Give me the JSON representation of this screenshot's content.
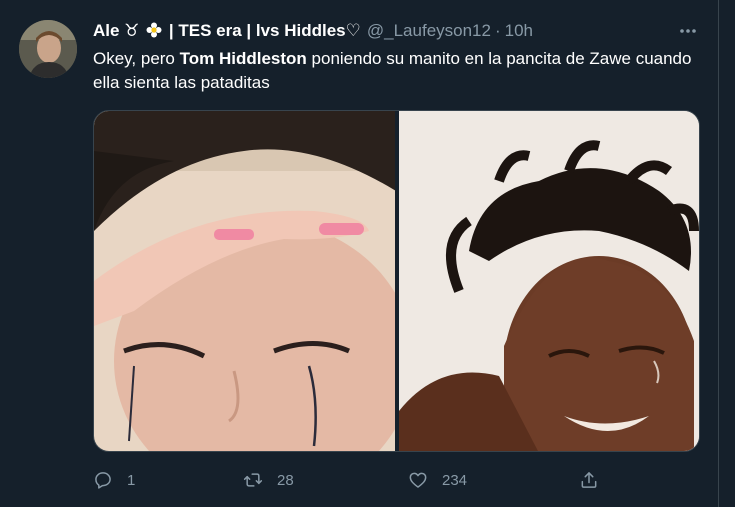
{
  "tweet": {
    "display_name_prefix": "Ale ♉︎",
    "display_name_suffix": "| TES era | lvs Hiddles♡",
    "handle": "@_Laufeyson12",
    "separator": "·",
    "time": "10h",
    "text_before": "Okey, pero ",
    "text_bold": "Tom Hiddleston",
    "text_after": " poniendo su manito en la pancita de Zawe cuando ella sienta las pataditas"
  },
  "actions": {
    "reply_count": "1",
    "retweet_count": "28",
    "like_count": "234"
  },
  "colors": {
    "background": "#15202b",
    "secondary_text": "#8899a6",
    "border": "#38444d"
  },
  "icons": [
    "more-icon",
    "reply-icon",
    "retweet-icon",
    "like-icon",
    "share-icon",
    "flower-emoji-icon"
  ]
}
